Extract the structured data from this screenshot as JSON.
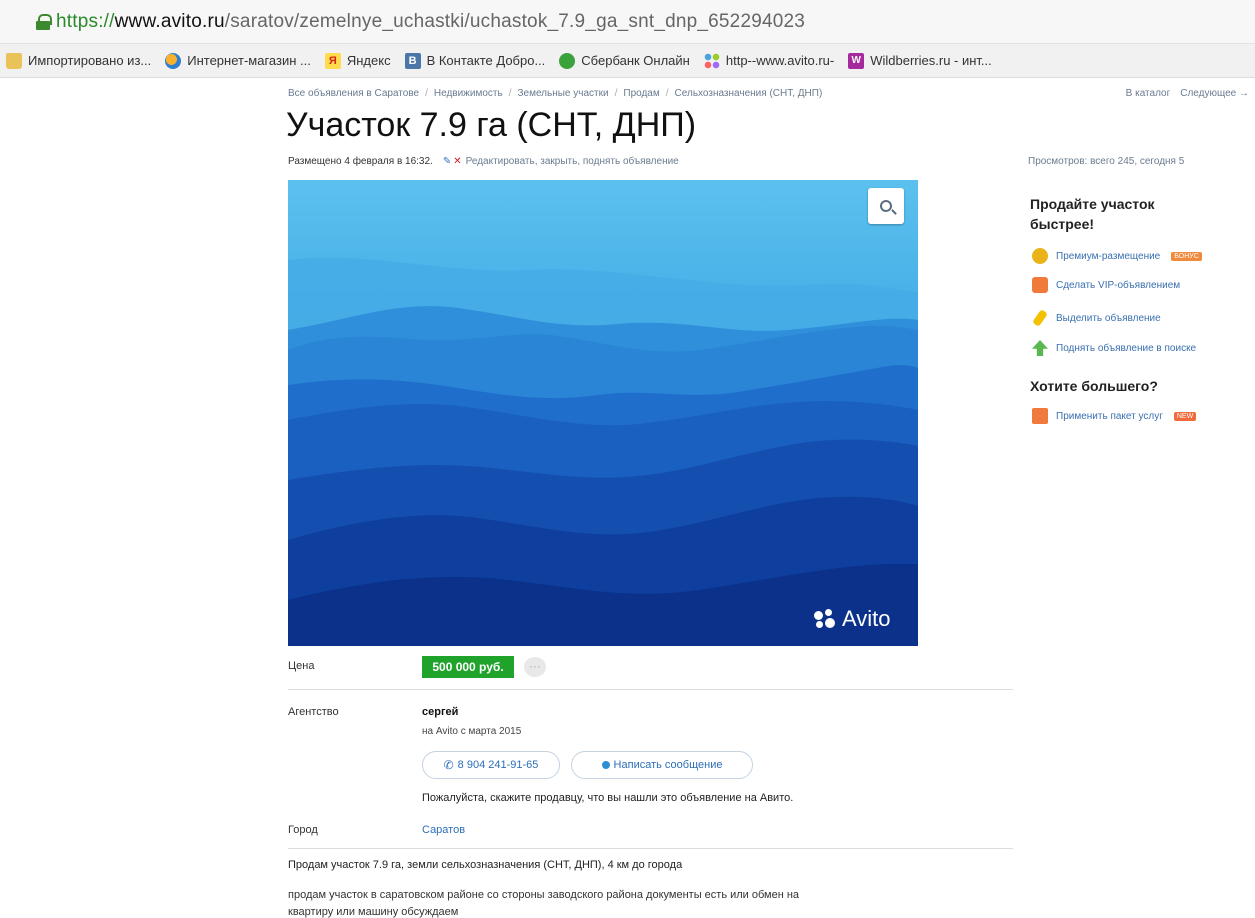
{
  "browser": {
    "url_scheme": "https://",
    "url_host": "www.avito.ru",
    "url_path": "/saratov/zemelnye_uchastki/uchastok_7.9_ga_snt_dnp_652294023",
    "bookmarks": [
      {
        "icon": "folder-icon",
        "label": "Импортировано из..."
      },
      {
        "icon": "ie-icon",
        "label": "Интернет-магазин ..."
      },
      {
        "icon": "yandex-icon",
        "label": "Яндекс"
      },
      {
        "icon": "vk-icon",
        "label": "В Контакте  Добро..."
      },
      {
        "icon": "sberbank-icon",
        "label": "Сбербанк Онлайн"
      },
      {
        "icon": "avito-icon",
        "label": "http--www.avito.ru-"
      },
      {
        "icon": "wildberries-icon",
        "label": "Wildberries.ru - инт..."
      }
    ]
  },
  "breadcrumb": [
    "Все объявления в Саратове",
    "Недвижимость",
    "Земельные участки",
    "Продам",
    "Сельхозназначения (СНТ, ДНП)"
  ],
  "top_nav": {
    "catalog": "В каталог",
    "next": "Следующее →"
  },
  "listing": {
    "title": "Участок 7.9 га (СНТ, ДНП)",
    "posted": "Размещено 4 февраля в 16:32.",
    "edit_links": "Редактировать, закрыть, поднять объявление",
    "views": "Просмотров: всего 245, сегодня 5",
    "watermark": "Avito",
    "price_label": "Цена",
    "price_value": "500 000 руб.",
    "price_more": "···",
    "agency_label": "Агентство",
    "seller_name": "сергей",
    "seller_since": "на Avito с марта 2015",
    "phone_button": "8 904 241-91-65",
    "message_button": "Написать сообщение",
    "notice": "Пожалуйста, скажите продавцу, что вы нашли это объявление на Авито.",
    "city_label": "Город",
    "city_value": "Саратов",
    "desc_line1": "Продам участок 7.9 га, земли сельхозназначения (СНТ, ДНП), 4 км до города",
    "desc_line2": "продам участок в саратовском районе со стороны заводского района документы есть или обмен на",
    "desc_line3": "квартиру или машину обсуждаем"
  },
  "sidebar": {
    "promo_title": "Продайте участок быстрее!",
    "items": [
      {
        "icon": "premium-icon",
        "label": "Премиум-размещение",
        "badge": "БОНУС",
        "color": "#e8b41a"
      },
      {
        "icon": "vip-icon",
        "label": "Сделать VIP-объявлением",
        "badge": "",
        "color": "#f07a3c"
      },
      {
        "icon": "highlight-icon",
        "label": "Выделить объявление",
        "badge": "",
        "color": "#f2c100"
      },
      {
        "icon": "raise-icon",
        "label": "Поднять объявление в поиске",
        "badge": "",
        "color": "#59b84f"
      }
    ],
    "more_title": "Хотите большего?",
    "package": {
      "icon": "package-icon",
      "label": "Применить пакет услуг",
      "badge": "NEW"
    }
  },
  "colors": {
    "price_green": "#20a32b",
    "link_blue": "#2c6fb7",
    "sky_top": "#5cc1ee",
    "sky_bottom": "#0b2f86"
  }
}
